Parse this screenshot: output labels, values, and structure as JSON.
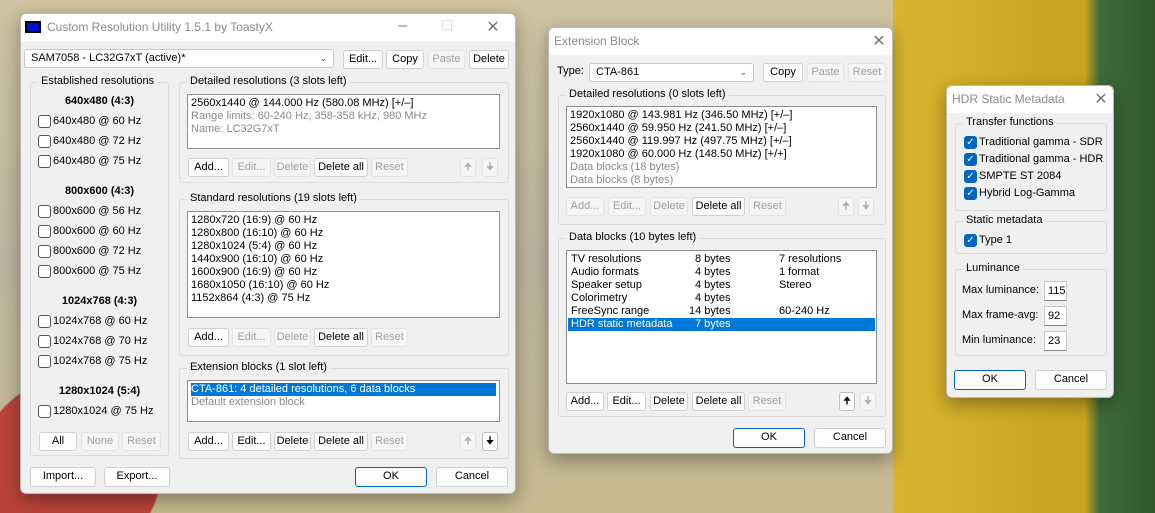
{
  "main": {
    "title": "Custom Resolution Utility 1.5.1 by ToastyX",
    "monitor": "SAM7058 - LC32G7xT (active)*",
    "top_buttons": {
      "edit": "Edit...",
      "copy": "Copy",
      "paste": "Paste",
      "delete": "Delete"
    },
    "established": {
      "title": "Established resolutions",
      "groups": [
        {
          "header": "640x480 (4:3)",
          "items": [
            "640x480 @ 60 Hz",
            "640x480 @ 72 Hz",
            "640x480 @ 75 Hz"
          ]
        },
        {
          "header": "800x600 (4:3)",
          "items": [
            "800x600 @ 56 Hz",
            "800x600 @ 60 Hz",
            "800x600 @ 72 Hz",
            "800x600 @ 75 Hz"
          ]
        },
        {
          "header": "1024x768 (4:3)",
          "items": [
            "1024x768 @ 60 Hz",
            "1024x768 @ 70 Hz",
            "1024x768 @ 75 Hz"
          ]
        },
        {
          "header": "1280x1024 (5:4)",
          "items": [
            "1280x1024 @ 75 Hz"
          ]
        }
      ],
      "buttons": {
        "all": "All",
        "none": "None",
        "reset": "Reset"
      }
    },
    "detailed": {
      "title": "Detailed resolutions (3 slots left)",
      "items": [
        "2560x1440 @ 144.000 Hz (580.08 MHz) [+/–]",
        "Range limits: 60-240 Hz, 358-358 kHz, 980 MHz",
        "Name: LC32G7xT"
      ]
    },
    "standard": {
      "title": "Standard resolutions (19 slots left)",
      "items": [
        "1280x720 (16:9) @ 60 Hz",
        "1280x800 (16:10) @ 60 Hz",
        "1280x1024 (5:4) @ 60 Hz",
        "1440x900 (16:10) @ 60 Hz",
        "1600x900 (16:9) @ 60 Hz",
        "1680x1050 (16:10) @ 60 Hz",
        "1152x864 (4:3) @ 75 Hz"
      ]
    },
    "extension": {
      "title": "Extension blocks (1 slot left)",
      "items": [
        "CTA-861: 4 detailed resolutions, 6 data blocks",
        "Default extension block"
      ]
    },
    "list_buttons": {
      "add": "Add...",
      "edit": "Edit...",
      "delete": "Delete",
      "delete_all": "Delete all",
      "reset": "Reset"
    },
    "import": "Import...",
    "export": "Export...",
    "ok": "OK",
    "cancel": "Cancel"
  },
  "ext": {
    "title": "Extension Block",
    "type_label": "Type:",
    "type_value": "CTA-861",
    "copy": "Copy",
    "paste": "Paste",
    "reset": "Reset",
    "detailed": {
      "title": "Detailed resolutions (0 slots left)",
      "items": [
        "1920x1080 @ 143.981 Hz (346.50 MHz) [+/–]",
        "2560x1440 @ 59.950 Hz (241.50 MHz) [+/–]",
        "2560x1440 @ 119.997 Hz (497.75 MHz) [+/–]",
        "1920x1080 @ 60.000 Hz (148.50 MHz) [+/+]",
        "Data blocks (18 bytes)",
        "Data blocks (8 bytes)"
      ]
    },
    "data_blocks": {
      "title": "Data blocks (10 bytes left)",
      "rows": [
        {
          "name": "TV resolutions",
          "size": "8 bytes",
          "info": "7 resolutions"
        },
        {
          "name": "Audio formats",
          "size": "4 bytes",
          "info": "1 format"
        },
        {
          "name": "Speaker setup",
          "size": "4 bytes",
          "info": "Stereo"
        },
        {
          "name": "Colorimetry",
          "size": "4 bytes",
          "info": ""
        },
        {
          "name": "FreeSync range",
          "size": "14 bytes",
          "info": "60-240 Hz"
        },
        {
          "name": "HDR static metadata",
          "size": "7 bytes",
          "info": ""
        }
      ],
      "selected": "HDR static metadata"
    },
    "list_buttons": {
      "add": "Add...",
      "edit": "Edit...",
      "delete": "Delete",
      "delete_all": "Delete all",
      "reset": "Reset"
    },
    "ok": "OK",
    "cancel": "Cancel"
  },
  "hdr": {
    "title": "HDR Static Metadata",
    "transfer": {
      "title": "Transfer functions",
      "items": [
        "Traditional gamma - SDR",
        "Traditional gamma - HDR",
        "SMPTE ST 2084",
        "Hybrid Log-Gamma"
      ]
    },
    "static": {
      "title": "Static metadata",
      "items": [
        "Type 1"
      ]
    },
    "luminance": {
      "title": "Luminance",
      "max_label": "Max luminance:",
      "max": "115",
      "avg_label": "Max frame-avg:",
      "avg": "92",
      "min_label": "Min luminance:",
      "min": "23"
    },
    "ok": "OK",
    "cancel": "Cancel"
  },
  "colors": {
    "accent": "#0067c0",
    "selection": "#0078d7"
  }
}
